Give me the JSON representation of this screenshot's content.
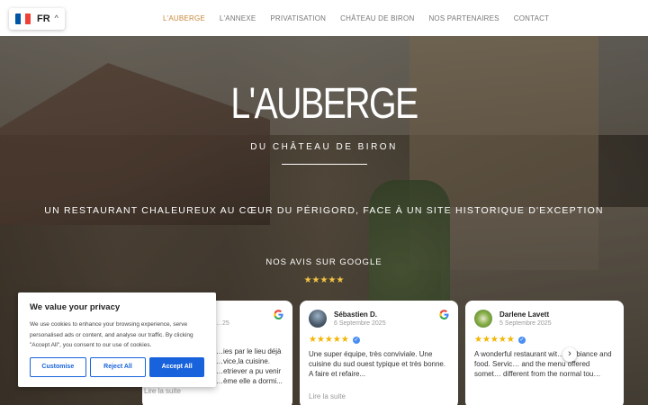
{
  "nav": {
    "language": "FR",
    "items": [
      "L'AUBERGE",
      "L'ANNEXE",
      "PRIVATISATION",
      "CHÂTEAU DE BIRON",
      "NOS PARTENAIRES",
      "CONTACT"
    ],
    "active_index": 0,
    "active_color": "#c8883c"
  },
  "hero": {
    "title": "L'AUBERGE",
    "subtitle": "DU CHÂTEAU DE BIRON",
    "tagline": "UN RESTAURANT CHALEUREUX AU CŒUR DU PÉRIGORD, FACE À UN SITE HISTORIQUE D'EXCEPTION"
  },
  "reviews": {
    "heading": "NOS AVIS SUR GOOGLE",
    "summary_stars": "★★★★★",
    "items": [
      {
        "partial": true,
        "date": "…25",
        "text_lines": [
          "…ies par le lieu déjà",
          "…vice,la cuisine.",
          "…etriever a pu venir",
          "…ème elle a dormi..."
        ],
        "more": "Lire la suite"
      },
      {
        "name": "Sébastien D.",
        "date": "6 Septembre 2025",
        "rating": 5,
        "text": "Une super équipe, très conviviale. Une cuisine du sud ouest typique et très bonne. A faire et refaire...",
        "more": "Lire la suite"
      },
      {
        "name": "Darlene Lavett",
        "date": "5 Septembre 2025",
        "rating": 5,
        "text": "A wonderful restaurant wit… ambiance and food. Servic… and the menu offered somet… different from the normal tou…",
        "more": ""
      }
    ]
  },
  "cookie": {
    "title": "We value your privacy",
    "body": "We use cookies to enhance your browsing experience, serve personalised ads or content, and analyse our traffic. By clicking \"Accept All\", you consent to our use of cookies.",
    "customise": "Customise",
    "reject": "Reject All",
    "accept": "Accept All",
    "accent_color": "#1863dc"
  }
}
